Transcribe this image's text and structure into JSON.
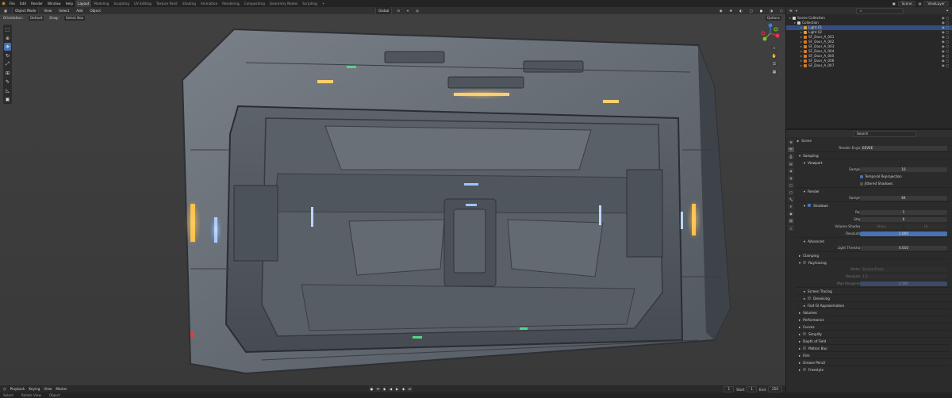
{
  "topbar": {
    "menu": [
      "File",
      "Edit",
      "Render",
      "Window",
      "Help"
    ],
    "workspaces": [
      "Layout",
      "Modeling",
      "Sculpting",
      "UV Editing",
      "Texture Paint",
      "Shading",
      "Animation",
      "Rendering",
      "Compositing",
      "Geometry Nodes",
      "Scripting",
      "+"
    ],
    "active_workspace": "Layout",
    "scene": "Scene",
    "view_layer": "ViewLayer"
  },
  "viewport": {
    "mode": "Object Mode",
    "menus": [
      "View",
      "Select",
      "Add",
      "Object"
    ],
    "orientation_label": "Orientation:",
    "orientation_value": "Default",
    "drag_label": "Drag:",
    "drag_value": "Select Box",
    "transform_space": "Global",
    "options": "Options",
    "tools": [
      "select",
      "cursor",
      "move",
      "rotate",
      "scale",
      "transform",
      "annotate",
      "measure",
      "add-cube"
    ],
    "active_tool": "move"
  },
  "outliner": {
    "search_placeholder": "",
    "scene_collection": "Scene Collection",
    "collection": "Collection",
    "items": [
      {
        "name": "Light.01",
        "type": "light",
        "selected": true
      },
      {
        "name": "Light.02",
        "type": "light",
        "selected": false
      },
      {
        "name": "SF_Door_A_001",
        "type": "mesh",
        "selected": false
      },
      {
        "name": "SF_Door_A_002",
        "type": "mesh",
        "selected": false
      },
      {
        "name": "SF_Door_A_003",
        "type": "mesh",
        "selected": false
      },
      {
        "name": "SF_Door_A_004",
        "type": "mesh",
        "selected": false
      },
      {
        "name": "SF_Door_A_005",
        "type": "mesh",
        "selected": false
      },
      {
        "name": "SF_Door_A_006",
        "type": "mesh",
        "selected": false
      },
      {
        "name": "SF_Door_A_007",
        "type": "mesh",
        "selected": false
      }
    ]
  },
  "properties": {
    "search_placeholder": "Search",
    "scene": "Scene",
    "render_engine_label": "Render Engine",
    "render_engine": "EEVEE",
    "sampling": "Sampling",
    "viewport": "Viewport",
    "samples_label": "Samples",
    "viewport_samples": "16",
    "temporal_reprojection": "Temporal Reprojection",
    "jittered_shadows": "Jittered Shadows",
    "render": "Render",
    "render_samples": "64",
    "shadows": "Shadows",
    "rays_label": "Rays",
    "rays": "1",
    "steps_label": "Steps",
    "steps": "6",
    "volume_shadows_label": "Volume Shadows",
    "volume_shadows": "Steps",
    "volume_steps": "16",
    "resolution_label": "Resolution",
    "resolution": "1.000",
    "advanced": "Advanced",
    "light_threshold_label": "Light Threshold",
    "light_threshold": "0.010",
    "clamping": "Clamping",
    "raytracing": "Raytracing",
    "method_label": "Method",
    "method": "Screen-Trace",
    "resolution2": "1:2",
    "max_roughness_label": "Max Roughness",
    "max_roughness": "0.500",
    "screen_tracing": "Screen Tracing",
    "denoising": "Denoising",
    "fast_gi": "Fast GI Approximation",
    "sections": [
      "Volumes",
      "Performance",
      "Curves",
      "Simplify",
      "Depth of Field",
      "Motion Blur",
      "Film",
      "Grease Pencil",
      "Freestyle"
    ]
  },
  "timeline": {
    "menus": [
      "Playback",
      "Keying",
      "View",
      "Marker"
    ],
    "current_frame": "1",
    "start_label": "Start",
    "start": "1",
    "end_label": "End",
    "end": "250"
  },
  "status": {
    "select": "Select",
    "rotate": "Rotate View",
    "object": "Object"
  }
}
